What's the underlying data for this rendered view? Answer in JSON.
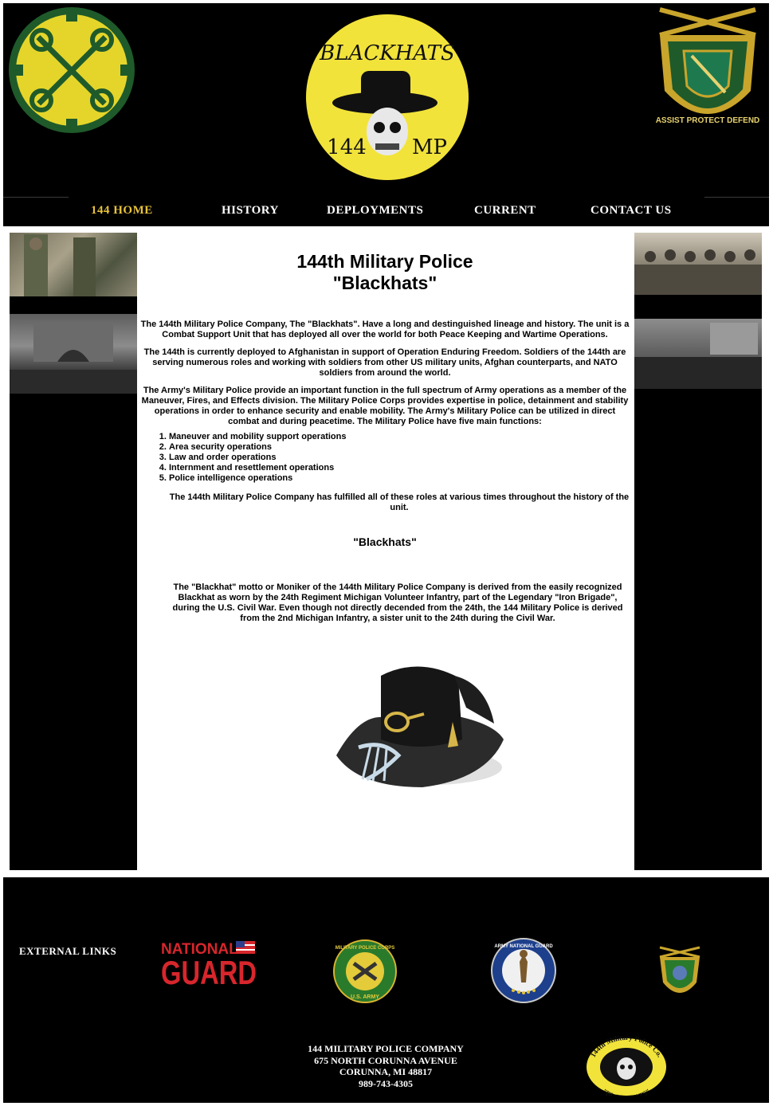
{
  "nav": {
    "items": [
      {
        "label": "144 HOME",
        "active": true
      },
      {
        "label": "HISTORY",
        "active": false
      },
      {
        "label": "DEPLOYMENTS",
        "active": false
      },
      {
        "label": "CURRENT",
        "active": false
      },
      {
        "label": "CONTACT US",
        "active": false
      }
    ]
  },
  "header": {
    "center_logo": {
      "top_text": "BLACKHATS",
      "left_text": "144",
      "right_text": "MP"
    },
    "right_crest": {
      "ring_text": "ASSIST PROTECT DEFEND"
    }
  },
  "main": {
    "title_line1": "144th Military Police",
    "title_line2": "\"Blackhats\"",
    "para1": "The 144th Military Police Company, The \"Blackhats\". Have a long and destinguished lineage and history. The unit is a Combat Support Unit that has deployed all over the world for both Peace Keeping and Wartime Operations.",
    "para2": "The 144th is currently deployed to Afghanistan in support of Operation Enduring Freedom. Soldiers of the 144th are serving numerous roles and working with soldiers from other US military units, Afghan counterparts, and NATO soldiers from around the world.",
    "para3": "The Army's Military Police provide an important function in the full spectrum of Army operations as a member of the Maneuver, Fires, and Effects division. The Military Police Corps provides expertise in police, detainment and stability operations in order to enhance security and enable mobility. The Army's Military Police can be utilized in direct combat and during peacetime. The Military Police have five main functions:",
    "functions": [
      "Maneuver and mobility support operations",
      "Area security operations",
      "Law and order operations",
      "Internment and resettlement operations",
      "Police intelligence operations"
    ],
    "para4": "The 144th Military Police Company has fulfilled all of these roles at various times throughout the history of the unit.",
    "subtitle": "\"Blackhats\"",
    "para5": "The \"Blackhat\" motto or Moniker of the 144th Military Police Company is derived from the easily recognized Blackhat as worn by the 24th Regiment Michigan Volunteer Infantry, part of the Legendary \"Iron Brigade\", during the U.S. Civil War. Even though not directly decended from the 24th, the 144 Military Police is derived from the 2nd Michigan Infantry, a sister unit to the 24th during the Civil War."
  },
  "footer": {
    "external_links_label": "EXTERNAL LINKS",
    "links": [
      {
        "name": "NATIONAL GUARD",
        "line1": "NATIONAL",
        "line2": "GUARD"
      },
      {
        "name": "Military Police Corps",
        "ring_top": "MILITARY POLICE CORPS",
        "ring_bottom": "U.S. ARMY"
      },
      {
        "name": "Army National Guard",
        "ring_text": "ARMY NATIONAL GUARD"
      },
      {
        "name": "Military Police crest"
      }
    ],
    "address": {
      "line1": "144 MILITARY POLICE COMPANY",
      "line2": "675 NORTH CORUNNA AVENUE",
      "line3": "CORUNNA, MI 48817",
      "line4": "989-743-4305"
    },
    "badge": {
      "top_text": "144th Military Police Co.",
      "bottom_text": "\"BLACKHATS\""
    }
  },
  "colors": {
    "nav_active": "#e7c23b",
    "badge_yellow": "#f2e33a",
    "green": "#1f5a2a",
    "gold": "#d9b531"
  }
}
